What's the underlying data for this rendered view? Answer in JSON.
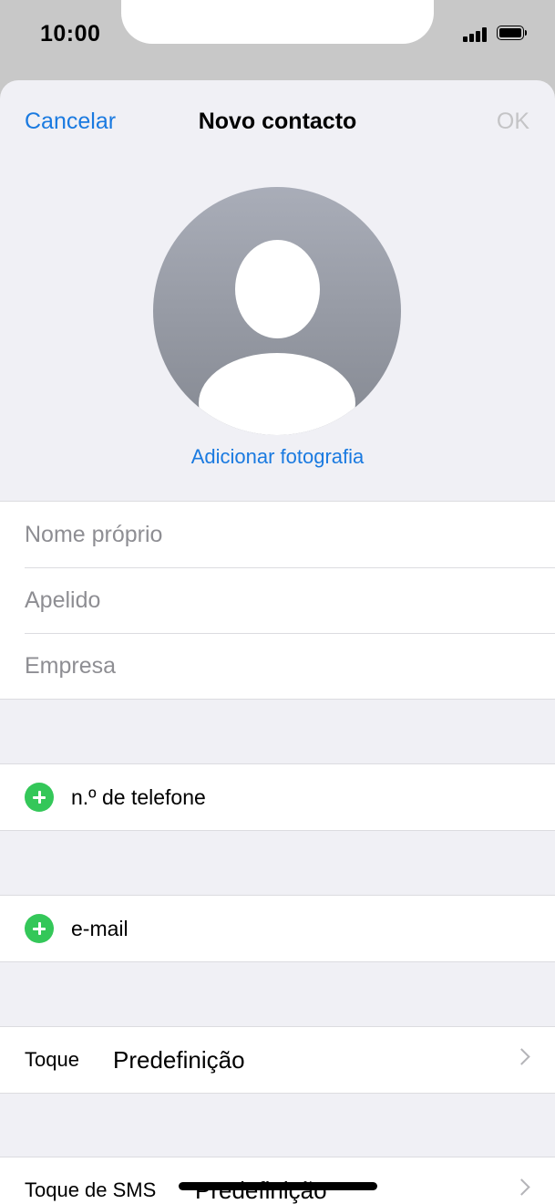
{
  "status_bar": {
    "time": "10:00"
  },
  "nav": {
    "cancel": "Cancelar",
    "title": "Novo contacto",
    "ok": "OK"
  },
  "photo": {
    "add_label": "Adicionar fotografia"
  },
  "name_fields": {
    "first_name": "Nome próprio",
    "last_name": "Apelido",
    "company": "Empresa"
  },
  "phone": {
    "add_label": "n.º de telefone"
  },
  "email": {
    "add_label": "e-mail"
  },
  "ringtone": {
    "label": "Toque",
    "value": "Predefinição"
  },
  "sms_tone": {
    "label": "Toque de SMS",
    "value": "Predefinição"
  }
}
